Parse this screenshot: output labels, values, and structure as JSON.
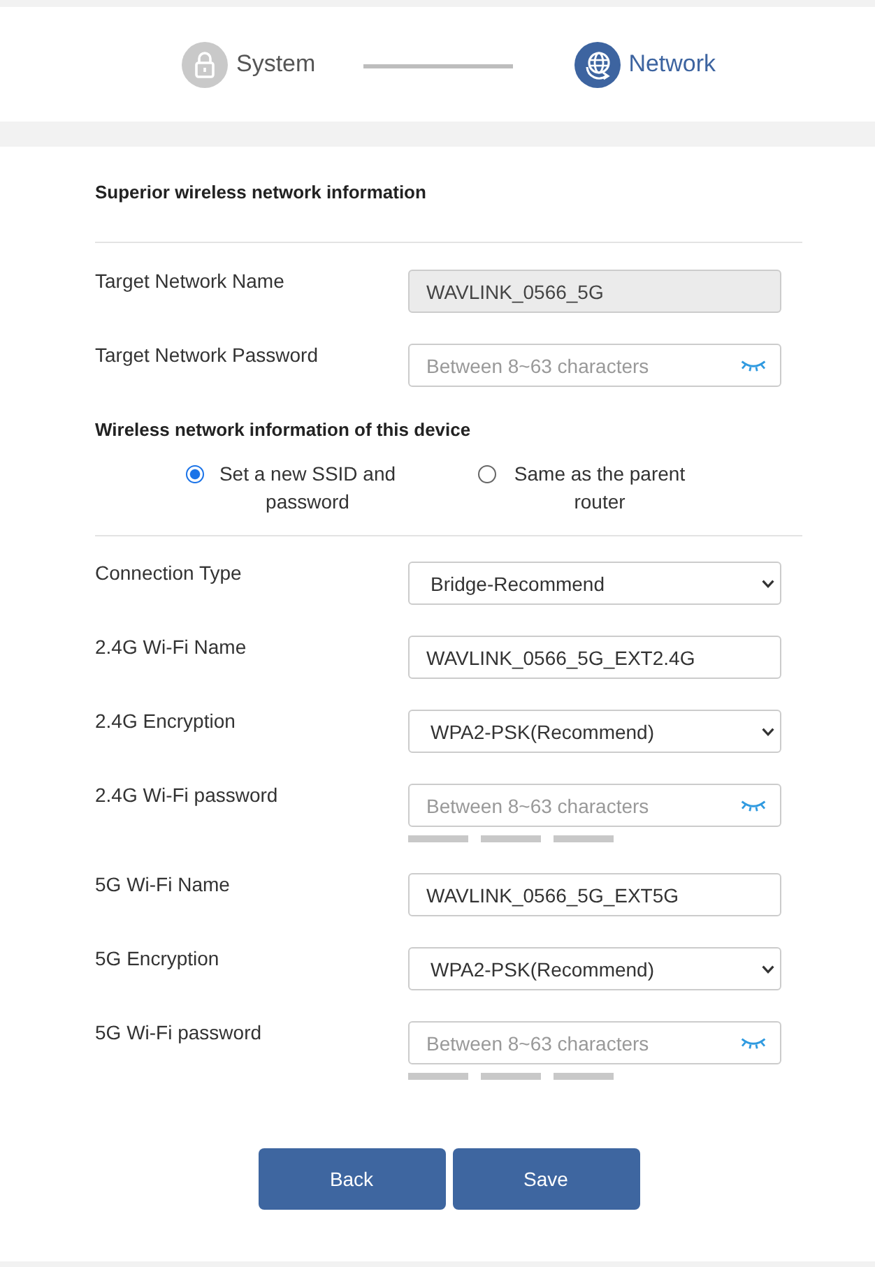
{
  "steps": [
    {
      "label": "System",
      "selected": false
    },
    {
      "label": "Network",
      "selected": true
    }
  ],
  "target": {
    "heading": "Superior wireless network information",
    "fields": [
      {
        "kind": "text",
        "label": "Target Network Name",
        "value": "WAVLINK_0566_5G",
        "disabled": true
      },
      {
        "kind": "password",
        "label": "Target Network Password",
        "placeholder": "Between 8~63 characters"
      }
    ]
  },
  "device": {
    "heading": "Wireless network information of this device",
    "options": [
      {
        "label": "Set a new SSID and password",
        "selected": true
      },
      {
        "label": "Same as the parent router",
        "selected": false
      }
    ],
    "fields": [
      {
        "kind": "select",
        "label": "Connection Type",
        "value": "Bridge-Recommend"
      },
      {
        "kind": "text",
        "label": "2.4G Wi-Fi Name",
        "value": "WAVLINK_0566_5G_EXT2.4G",
        "disabled": false
      },
      {
        "kind": "select",
        "label": "2.4G Encryption",
        "value": "WPA2-PSK(Recommend)"
      },
      {
        "kind": "password",
        "label": "2.4G Wi-Fi password",
        "placeholder": "Between 8~63 characters",
        "strength_meter": true
      },
      {
        "kind": "text",
        "label": "5G Wi-Fi Name",
        "value": "WAVLINK_0566_5G_EXT5G",
        "disabled": false
      },
      {
        "kind": "select",
        "label": "5G Encryption",
        "value": "WPA2-PSK(Recommend)"
      },
      {
        "kind": "password",
        "label": "5G Wi-Fi password",
        "placeholder": "Between 8~63 characters",
        "strength_meter": true
      }
    ]
  },
  "buttons": [
    {
      "label": "Back"
    },
    {
      "label": "Save"
    }
  ]
}
